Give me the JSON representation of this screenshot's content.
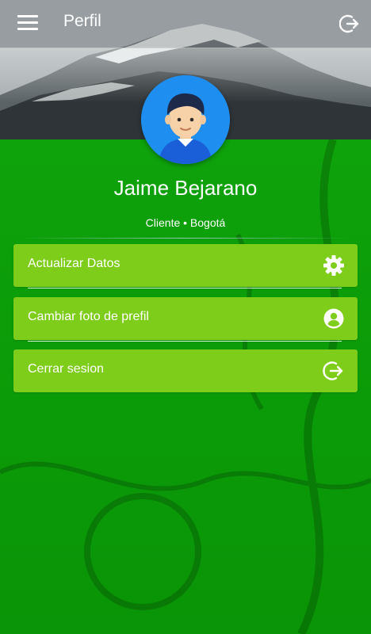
{
  "header": {
    "title": "Perfil",
    "menu_icon": "hamburger-menu-icon",
    "logout_icon": "logout-icon"
  },
  "profile": {
    "name": "Jaime Bejarano",
    "subtitle": "Cliente • Bogotá",
    "avatar_icon": "user-avatar-icon"
  },
  "actions": [
    {
      "label": "Actualizar Datos",
      "icon": "gear-icon"
    },
    {
      "label": "Cambiar foto de prefil",
      "icon": "account-circle-icon"
    },
    {
      "label": "Cerrar sesion",
      "icon": "logout-icon"
    }
  ],
  "colors": {
    "primary_green": "#0d9a0a",
    "card_green": "#7fcd1b",
    "avatar_blue": "#1e8ff0",
    "text": "#ffffff"
  }
}
